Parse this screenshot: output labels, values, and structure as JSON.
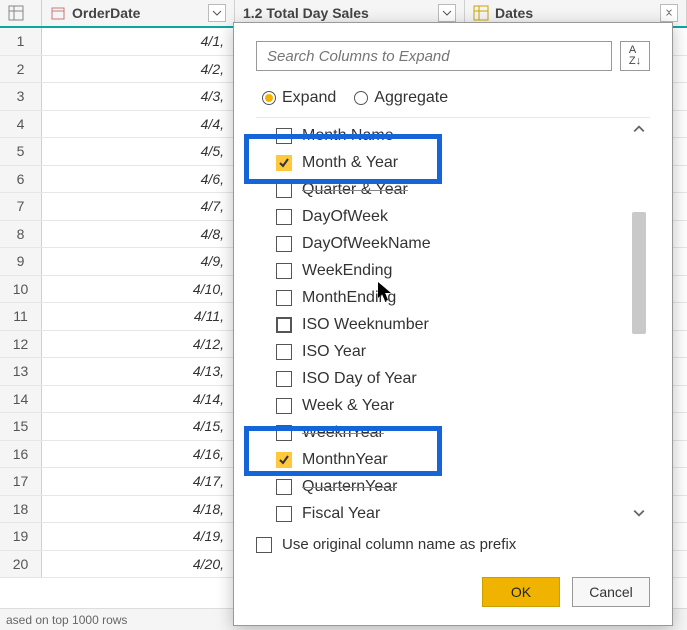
{
  "columns": {
    "col1_label": "OrderDate",
    "col2_label": "1.2 Total Day Sales",
    "col3_label": "Dates"
  },
  "rows": [
    {
      "n": "1",
      "date": "4/1,"
    },
    {
      "n": "2",
      "date": "4/2,"
    },
    {
      "n": "3",
      "date": "4/3,"
    },
    {
      "n": "4",
      "date": "4/4,"
    },
    {
      "n": "5",
      "date": "4/5,"
    },
    {
      "n": "6",
      "date": "4/6,"
    },
    {
      "n": "7",
      "date": "4/7,"
    },
    {
      "n": "8",
      "date": "4/8,"
    },
    {
      "n": "9",
      "date": "4/9,"
    },
    {
      "n": "10",
      "date": "4/10,"
    },
    {
      "n": "11",
      "date": "4/11,"
    },
    {
      "n": "12",
      "date": "4/12,"
    },
    {
      "n": "13",
      "date": "4/13,"
    },
    {
      "n": "14",
      "date": "4/14,"
    },
    {
      "n": "15",
      "date": "4/15,"
    },
    {
      "n": "16",
      "date": "4/16,"
    },
    {
      "n": "17",
      "date": "4/17,"
    },
    {
      "n": "18",
      "date": "4/18,"
    },
    {
      "n": "19",
      "date": "4/19,"
    },
    {
      "n": "20",
      "date": "4/20,"
    }
  ],
  "status_text": "ased on top 1000 rows",
  "popup": {
    "search_placeholder": "Search Columns to Expand",
    "sort_label": "A↓Z",
    "mode_expand": "Expand",
    "mode_aggregate": "Aggregate",
    "items": [
      {
        "label": "Month Name",
        "checked": false,
        "struck": true
      },
      {
        "label": "Month & Year",
        "checked": true
      },
      {
        "label": "Quarter & Year",
        "checked": false,
        "struck": true
      },
      {
        "label": "DayOfWeek",
        "checked": false
      },
      {
        "label": "DayOfWeekName",
        "checked": false
      },
      {
        "label": "WeekEnding",
        "checked": false
      },
      {
        "label": "MonthEnding",
        "checked": false
      },
      {
        "label": "ISO Weeknumber",
        "checked": false,
        "bold": true
      },
      {
        "label": "ISO Year",
        "checked": false
      },
      {
        "label": "ISO Day of Year",
        "checked": false
      },
      {
        "label": "Week & Year",
        "checked": false
      },
      {
        "label": "WeeknYear",
        "checked": false,
        "struck": true
      },
      {
        "label": "MonthnYear",
        "checked": true
      },
      {
        "label": "QuarternYear",
        "checked": false,
        "struck": true
      },
      {
        "label": "Fiscal Year",
        "checked": false
      }
    ],
    "prefix_label": "Use original column name as prefix",
    "ok_label": "OK",
    "cancel_label": "Cancel"
  }
}
